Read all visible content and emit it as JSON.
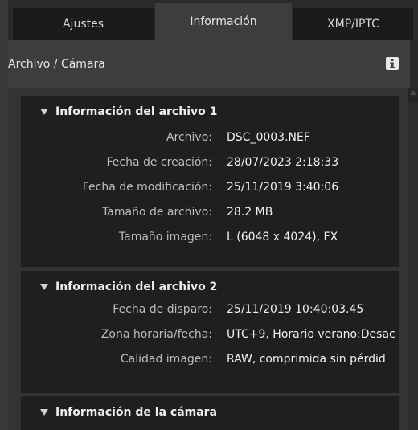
{
  "tabs": [
    {
      "label": "Ajustes"
    },
    {
      "label": "Información"
    },
    {
      "label": "XMP/IPTC"
    }
  ],
  "header": {
    "title": "Archivo / Cámara",
    "icon": "info-icon"
  },
  "sections": [
    {
      "title": "Información del archivo 1",
      "rows": [
        {
          "label": "Archivo:",
          "value": "DSC_0003.NEF"
        },
        {
          "label": "Fecha de creación:",
          "value": "28/07/2023 2:18:33"
        },
        {
          "label": "Fecha de modificación:",
          "value": "25/11/2019 3:40:06"
        },
        {
          "label": "Tamaño de archivo:",
          "value": "28.2 MB"
        },
        {
          "label": "Tamaño imagen:",
          "value": "L (6048 x 4024), FX"
        }
      ]
    },
    {
      "title": "Información del archivo 2",
      "rows": [
        {
          "label": "Fecha de disparo:",
          "value": "25/11/2019 10:40:03.45"
        },
        {
          "label": "Zona horaria/fecha:",
          "value": "UTC+9, Horario verano:Desac"
        },
        {
          "label": "Calidad imagen:",
          "value": "RAW, comprimida sin pérdid"
        }
      ]
    },
    {
      "title": "Información de la cámara",
      "rows": []
    }
  ]
}
